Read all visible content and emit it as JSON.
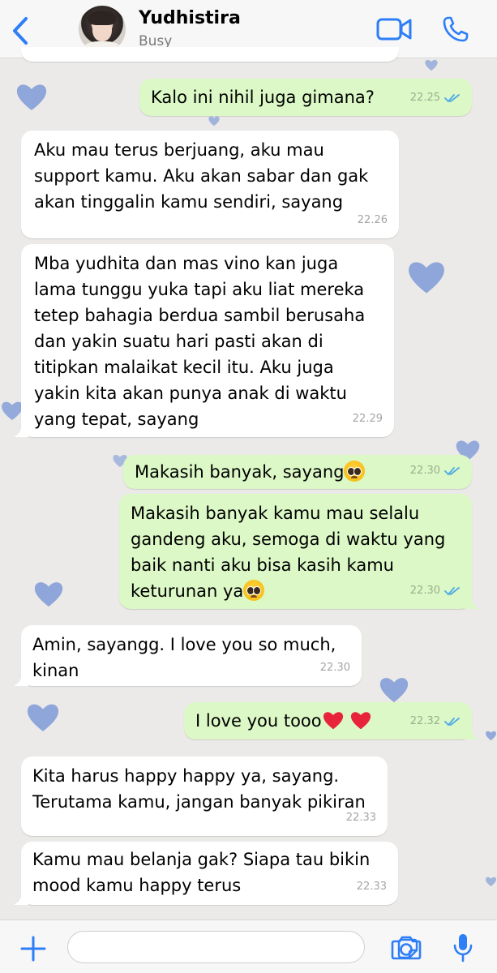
{
  "header": {
    "contact_name": "Yudhistira",
    "status": "Busy"
  },
  "colors": {
    "accent": "#2d7ef7",
    "outgoing_bubble": "#dcf8c6",
    "incoming_bubble": "#ffffff",
    "read_tick": "#4fa8e8",
    "heart": "#6f8fd4"
  },
  "messages": [
    {
      "direction": "out",
      "text": "Kalo ini nihil juga gimana?",
      "time": "22.25",
      "read": true
    },
    {
      "direction": "in",
      "text": "Aku mau terus berjuang, aku mau\nsupport kamu. Aku akan sabar dan gak\nakan tinggalin kamu sendiri, sayang",
      "time": "22.26"
    },
    {
      "direction": "in",
      "text": "Mba yudhita dan mas vino kan juga\nlama tunggu yuka tapi aku liat mereka\ntetep bahagia berdua sambil berusaha\ndan yakin suatu hari pasti akan di\ntitipkan malaikat kecil itu. Aku juga\nyakin kita akan punya anak di waktu\nyang tepat, sayang",
      "time": "22.29"
    },
    {
      "direction": "out",
      "text": "Makasih banyak, sayang",
      "emoji": "pleading-face",
      "time": "22.30",
      "read": true
    },
    {
      "direction": "out",
      "text": "Makasih banyak kamu mau selalu\ngandeng aku, semoga di waktu yang\nbaik nanti aku bisa kasih kamu\nketurunan ya",
      "emoji": "pleading-face",
      "time": "22.30",
      "read": true
    },
    {
      "direction": "in",
      "text": "Amin, sayangg. I love you so much,\nkinan",
      "time": "22.30"
    },
    {
      "direction": "out",
      "text": "I love you tooo",
      "emoji": "red-heart x2",
      "time": "22.32",
      "read": true
    },
    {
      "direction": "in",
      "text": "Kita harus happy happy ya, sayang.\nTerutama kamu, jangan banyak pikiran",
      "time": "22.33"
    },
    {
      "direction": "in",
      "text": "Kamu mau belanja gak? Siapa tau bikin\nmood kamu happy terus",
      "time": "22.33"
    }
  ],
  "input": {
    "placeholder": "",
    "icons": [
      "plus-icon",
      "sticker-icon",
      "camera-icon",
      "microphone-icon"
    ]
  }
}
